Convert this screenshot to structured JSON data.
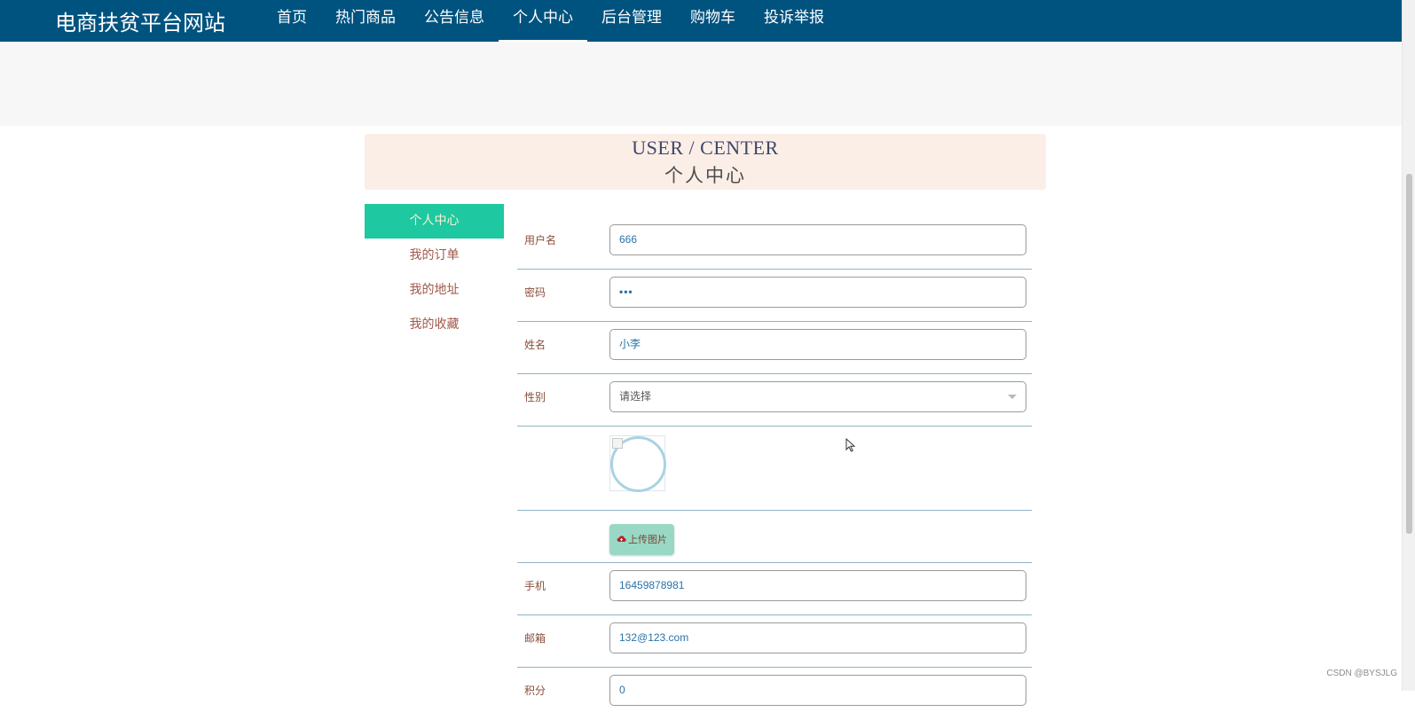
{
  "header": {
    "site_title": "电商扶贫平台网站",
    "nav": [
      {
        "label": "首页"
      },
      {
        "label": "热门商品"
      },
      {
        "label": "公告信息"
      },
      {
        "label": "个人中心",
        "active": true
      },
      {
        "label": "后台管理"
      },
      {
        "label": "购物车"
      },
      {
        "label": "投诉举报"
      }
    ]
  },
  "center_header": {
    "en": "USER / CENTER",
    "cn": "个人中心"
  },
  "side_menu": {
    "items": [
      {
        "label": "个人中心",
        "active": true
      },
      {
        "label": "我的订单"
      },
      {
        "label": "我的地址"
      },
      {
        "label": "我的收藏"
      }
    ]
  },
  "form": {
    "username": {
      "label": "用户名",
      "value": "666"
    },
    "password": {
      "label": "密码",
      "value": "•••"
    },
    "name": {
      "label": "姓名",
      "value": "小李"
    },
    "gender": {
      "label": "性别",
      "value": "请选择"
    },
    "upload_label": "上传图片",
    "phone": {
      "label": "手机",
      "value": "16459878981"
    },
    "email": {
      "label": "邮箱",
      "value": "132@123.com"
    },
    "points": {
      "label": "积分",
      "value": "0"
    }
  },
  "watermark": "CSDN @BYSJLG",
  "colors": {
    "topbar": "#00537f",
    "side_active": "#1ec8a0",
    "header_card": "#fbeee7",
    "upload_button": "#99d8c5"
  }
}
